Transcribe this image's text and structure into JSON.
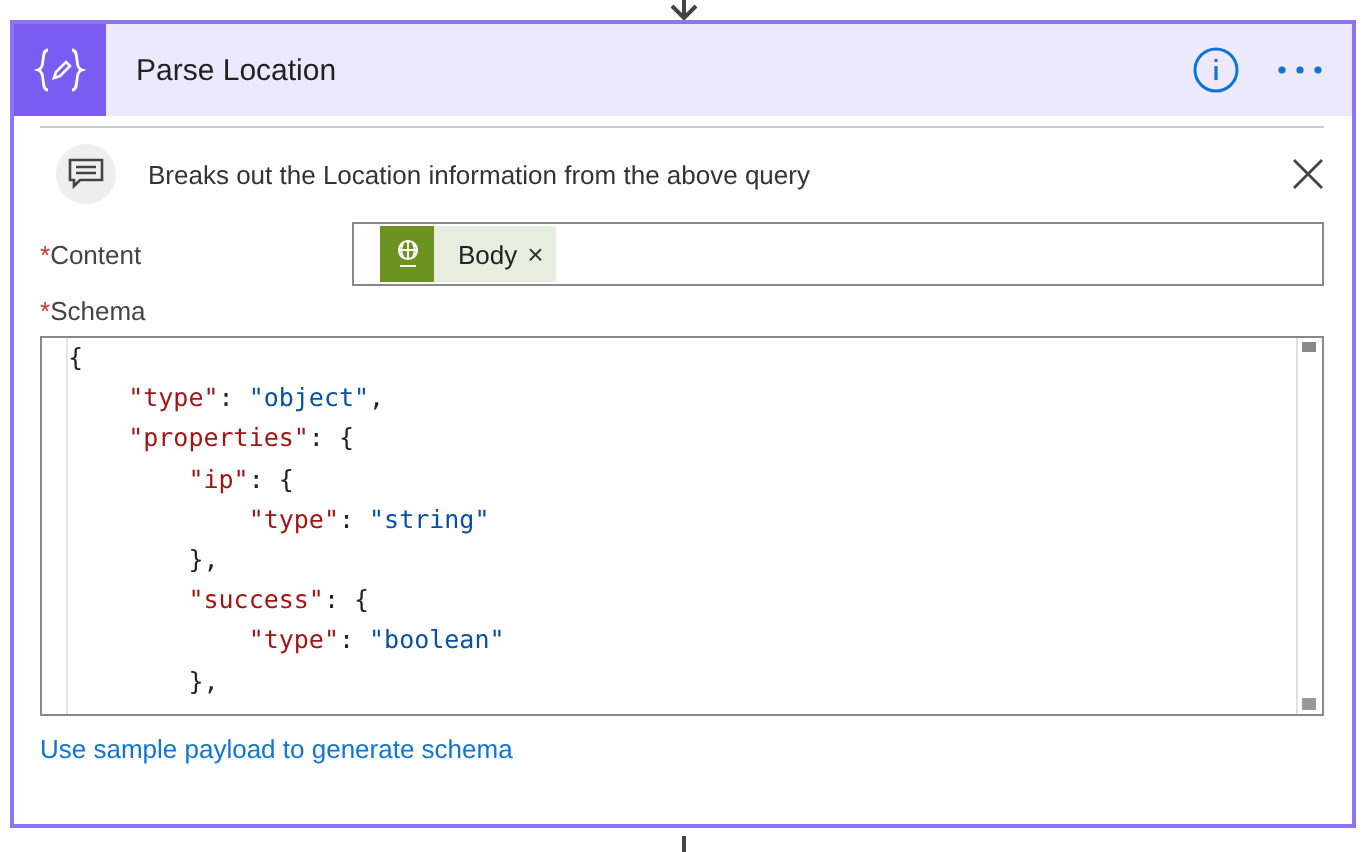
{
  "card": {
    "title": "Parse Location",
    "comment": "Breaks out the Location information from the above query",
    "fields": [
      {
        "label": "Content",
        "required": true,
        "required_mark": "*",
        "token": {
          "label": "Body",
          "remove": "×"
        }
      },
      {
        "label": "Schema",
        "required": true,
        "required_mark": "*"
      }
    ],
    "schema_lines": [
      "{",
      "    \"type\": \"object\",",
      "    \"properties\": {",
      "        \"ip\": {",
      "            \"type\": \"string\"",
      "        },",
      "        \"success\": {",
      "            \"type\": \"boolean\"",
      "        },"
    ],
    "link": "Use sample payload to generate schema"
  }
}
